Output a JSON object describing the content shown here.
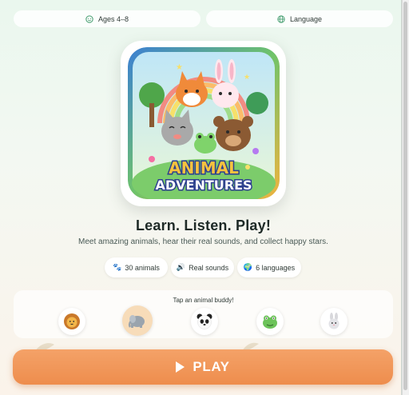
{
  "top_bar": {
    "ages_label": "Ages 4–8",
    "ages_icon": "smile-face-icon",
    "language_label": "Language",
    "language_icon": "globe-icon"
  },
  "logo": {
    "line1": "ANIMAL",
    "line2": "ADVENTURES"
  },
  "hero": {
    "headline": "Learn. Listen. Play!",
    "subline": "Meet amazing animals, hear their real sounds, and collect happy stars."
  },
  "features": [
    {
      "icon": "paw-icon",
      "glyph": "🐾",
      "label": "30 animals"
    },
    {
      "icon": "speaker-icon",
      "glyph": "🔊",
      "label": "Real sounds"
    },
    {
      "icon": "globe-icon",
      "glyph": "🌍",
      "label": "6 languages"
    }
  ],
  "buddies": {
    "title": "Tap an animal buddy!",
    "items": [
      {
        "name": "lion",
        "selected": false
      },
      {
        "name": "elephant",
        "selected": true
      },
      {
        "name": "panda",
        "selected": false
      },
      {
        "name": "frog",
        "selected": false
      },
      {
        "name": "rabbit",
        "selected": false
      }
    ]
  },
  "play_button": {
    "label": "PLAY",
    "color": "#ee8d4d"
  },
  "colors": {
    "accent": "#ee8d4d",
    "background": "#eaf7ee",
    "selected_buddy": "#f7dcb9"
  }
}
